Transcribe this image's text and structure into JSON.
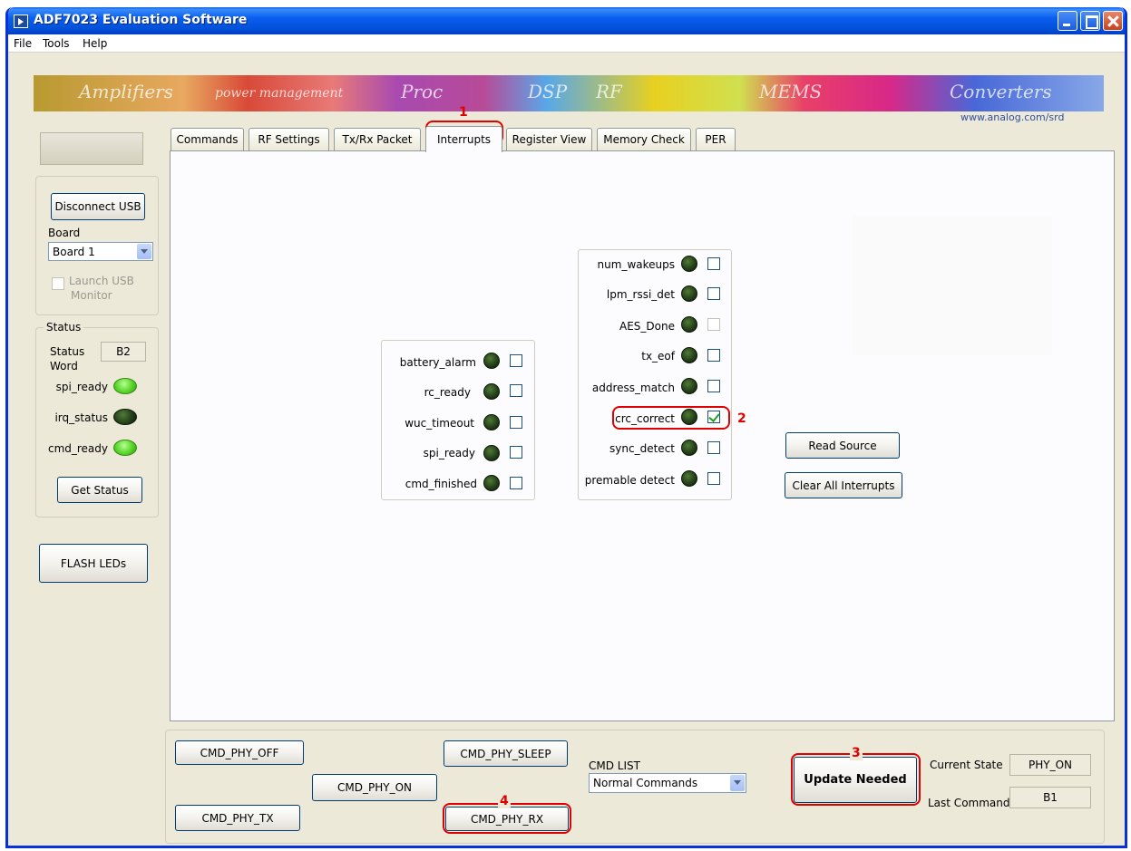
{
  "window": {
    "title": "ADF7023 Evaluation Software"
  },
  "menu": [
    "File",
    "Tools",
    "Help"
  ],
  "banner": {
    "words": [
      "Amplifiers",
      "power management",
      "Proc",
      "DSP",
      "RF",
      "MEMS",
      "Converters"
    ],
    "url": "www.analog.com/srd"
  },
  "left": {
    "disconnect_label": "Disconnect USB",
    "board_label": "Board",
    "board_value": "Board 1",
    "launch_monitor_label_1": "Launch USB",
    "launch_monitor_label_2": "Monitor",
    "status_group": "Status",
    "status_word_label_1": "Status",
    "status_word_label_2": "Word",
    "status_word_value": "B2",
    "spi_ready": "spi_ready",
    "irq_status": "irq_status",
    "cmd_ready": "cmd_ready",
    "get_status": "Get Status",
    "flash_leds": "FLASH LEDs"
  },
  "tabs": [
    "Commands",
    "RF Settings",
    "Tx/Rx Packet",
    "Interrupts",
    "Register View",
    "Memory Check",
    "PER"
  ],
  "interrupts": {
    "left_group": [
      {
        "name": "battery_alarm",
        "checked": false
      },
      {
        "name": "rc_ready",
        "checked": false
      },
      {
        "name": "wuc_timeout",
        "checked": false
      },
      {
        "name": "spi_ready",
        "checked": false
      },
      {
        "name": "cmd_finished",
        "checked": false
      }
    ],
    "right_group": [
      {
        "name": "num_wakeups",
        "checked": false
      },
      {
        "name": "lpm_rssi_det",
        "checked": false
      },
      {
        "name": "AES_Done",
        "checked": false
      },
      {
        "name": "tx_eof",
        "checked": false
      },
      {
        "name": "address_match",
        "checked": false
      },
      {
        "name": "crc_correct",
        "checked": true
      },
      {
        "name": "sync_detect",
        "checked": false
      },
      {
        "name": "premable detect",
        "checked": false
      }
    ],
    "read_source": "Read Source",
    "clear_all": "Clear All Interrupts"
  },
  "bottom": {
    "cmd_phy_off": "CMD_PHY_OFF",
    "cmd_phy_on": "CMD_PHY_ON",
    "cmd_phy_tx": "CMD_PHY_TX",
    "cmd_phy_sleep": "CMD_PHY_SLEEP",
    "cmd_phy_rx": "CMD_PHY_RX",
    "cmd_list_label": "CMD LIST",
    "cmd_list_value": "Normal Commands",
    "update_needed": "Update Needed",
    "current_state_label": "Current State",
    "current_state_value": "PHY_ON",
    "last_command_label": "Last Command",
    "last_command_value": "B1"
  },
  "annotations": [
    "1",
    "2",
    "3",
    "4"
  ],
  "colors": {
    "titlebar": "#0a5ef0",
    "annotation": "#e00000",
    "led_on": "#56d428",
    "led_off": "#25401a"
  }
}
